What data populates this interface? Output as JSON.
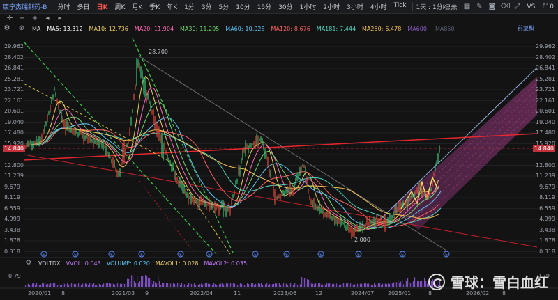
{
  "toolbar": {
    "title": "康宁杰瑞制药-B",
    "periods": [
      "分时",
      "多日",
      "日K",
      "周K",
      "月K",
      "季K",
      "年K",
      "1分",
      "3分",
      "5分",
      "10分",
      "15分",
      "30分",
      "1小时",
      "2小时",
      "3小时",
      "4小时",
      "Tick"
    ],
    "active_period": "日K",
    "adjust": "1天 : 1分K",
    "right": {
      "display": "显示",
      "vs": "VS",
      "f10": "F10"
    }
  },
  "ma_bar": {
    "label": "MA",
    "items": [
      {
        "name": "MA5:",
        "value": "13.312",
        "color": "#ffffff"
      },
      {
        "name": "MA10:",
        "value": "12.736",
        "color": "#f0d05a"
      },
      {
        "name": "MA20:",
        "value": "11.904",
        "color": "#ff6ab3"
      },
      {
        "name": "MA30:",
        "value": "11.205",
        "color": "#6fd86f"
      },
      {
        "name": "MA60:",
        "value": "10.028",
        "color": "#5ac8fa"
      },
      {
        "name": "MA120:",
        "value": "8.676",
        "color": "#ff6060"
      },
      {
        "name": "MA181:",
        "value": "7.444",
        "color": "#4fd6c0"
      },
      {
        "name": "MA250:",
        "value": "6.478",
        "color": "#f2c14e"
      },
      {
        "name": "MA600",
        "value": "",
        "color": "#8a5bbf"
      },
      {
        "name": "MA850",
        "value": "",
        "color": "#556070"
      }
    ],
    "restore_label": "前复权"
  },
  "price_axis": [
    "29.962",
    "28.402",
    "26.841",
    "25.281",
    "23.721",
    "22.161",
    "20.601",
    "19.040",
    "17.480",
    "15.920",
    "14.840",
    "12.800",
    "11.239",
    "9.679",
    "8.119",
    "6.559",
    "4.999",
    "3.438",
    "1.878",
    "0.318"
  ],
  "current_price": "14.840",
  "annotations": {
    "high": "28.700",
    "low": "2.000"
  },
  "indicator": {
    "name": "VOLTDX",
    "items": [
      {
        "name": "VVOL:",
        "value": "0.043",
        "color": "#c77dff"
      },
      {
        "name": "VOLUME:",
        "value": "0.020",
        "color": "#5ac8fa"
      },
      {
        "name": "MAVOL1:",
        "value": "0.028",
        "color": "#f0d05a"
      },
      {
        "name": "MAVOL2:",
        "value": "0.035",
        "color": "#c77dff"
      }
    ],
    "axis": [
      "0.79",
      "0.79"
    ]
  },
  "time_axis": [
    "2020/01",
    "8",
    "2021/03",
    "9",
    "2022/04",
    "11",
    "2023/06",
    "12",
    "2024/07",
    "2025/01",
    "8",
    "2026/02",
    "8"
  ],
  "event_marker": "E",
  "watermark": {
    "text": "雪球：雪白血红"
  },
  "colors": {
    "background": "#131314",
    "active_red": "#ff5a4f",
    "link_blue": "#7ea6ff",
    "trend_red": "#e8262e",
    "channel_purple": "#8b3a7a"
  }
}
